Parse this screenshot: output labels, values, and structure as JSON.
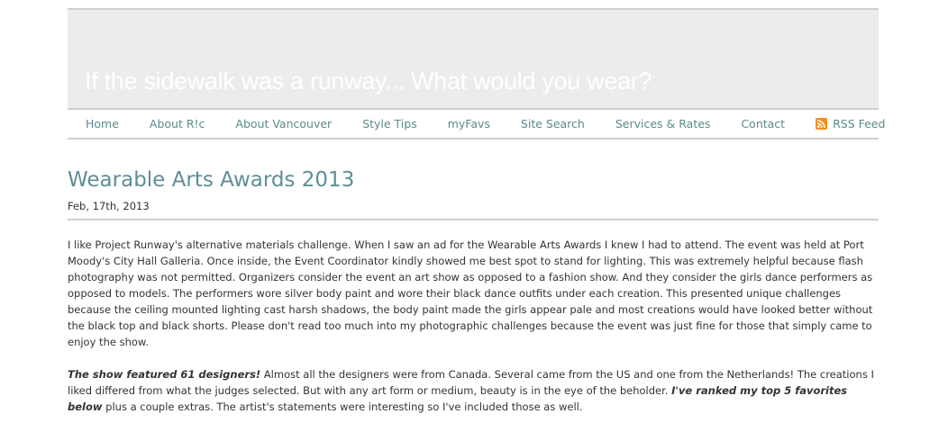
{
  "header": {
    "tagline": "If the sidewalk was a runway... What would you wear?"
  },
  "nav": {
    "items": [
      {
        "label": "Home"
      },
      {
        "label": "About R!c"
      },
      {
        "label": "About Vancouver"
      },
      {
        "label": "Style Tips"
      },
      {
        "label": "myFavs"
      },
      {
        "label": "Site Search"
      },
      {
        "label": "Services & Rates"
      },
      {
        "label": "Contact"
      },
      {
        "label": "RSS Feed",
        "icon": "rss-icon"
      }
    ]
  },
  "post": {
    "title": "Wearable Arts Awards 2013",
    "date": "Feb, 17th, 2013",
    "paragraph1": "I like Project Runway's alternative materials challenge. When I saw an ad for the Wearable Arts Awards I knew I had to attend. The event was held at Port Moody's City Hall Galleria. Once inside, the Event Coordinator kindly showed me best spot to stand for lighting. This was extremely helpful because flash photography was not permitted. Organizers consider the event an art show as opposed to a fashion show. And they consider the girls dance performers as opposed to models. The performers wore silver body paint and wore their black dance outfits under each creation. This presented unique challenges because the ceiling mounted lighting cast harsh shadows, the body paint made the girls appear pale and most creations would have looked better without the black top and black shorts. Please don't read too much into my photographic challenges because the event was just fine for those that simply came to enjoy the show.",
    "paragraph2_emphasis1": "The show featured 61 designers!",
    "paragraph2_text1": " Almost all the designers were from Canada. Several came from the US and one from the Netherlands! The creations I liked differed from what the judges selected. But with any art form or medium, beauty is in the eye of the beholder. ",
    "paragraph2_emphasis2": "I've ranked my top 5 favorites below",
    "paragraph2_text2": " plus a couple extras. The artist's statements were interesting so I've included those as well."
  },
  "colors": {
    "banner_bg": "#ececec",
    "nav_link": "#5a8a8a",
    "title": "#5f8e96",
    "rss": "#f18f1e"
  }
}
